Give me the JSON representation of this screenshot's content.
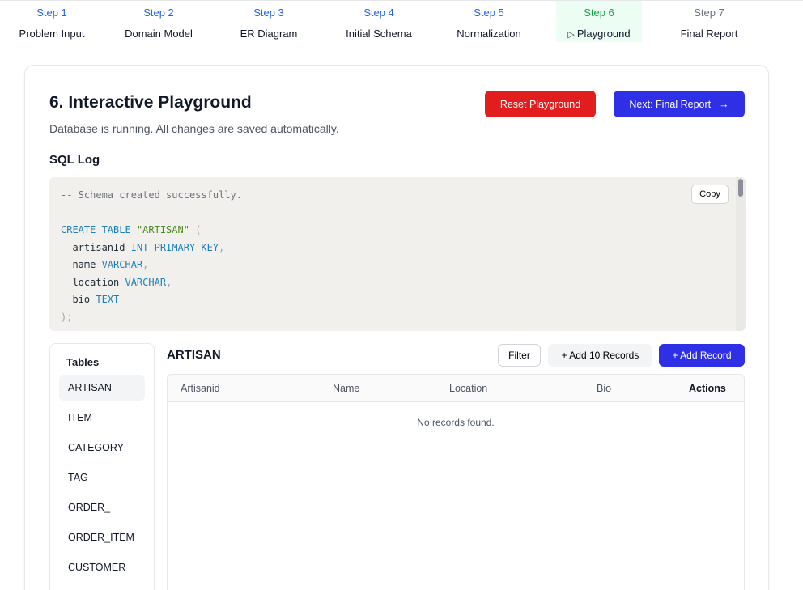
{
  "steps": [
    {
      "num": "Step 1",
      "label": "Problem Input"
    },
    {
      "num": "Step 2",
      "label": "Domain Model"
    },
    {
      "num": "Step 3",
      "label": "ER Diagram"
    },
    {
      "num": "Step 4",
      "label": "Initial Schema"
    },
    {
      "num": "Step 5",
      "label": "Normalization"
    },
    {
      "num": "Step 6",
      "label": "Playground"
    },
    {
      "num": "Step 7",
      "label": "Final Report"
    }
  ],
  "page": {
    "title": "6. Interactive Playground",
    "subtitle": "Database is running. All changes are saved automatically.",
    "reset_label": "Reset Playground",
    "next_label": "Next: Final Report",
    "next_arrow": "→"
  },
  "sql": {
    "heading": "SQL Log",
    "copy_label": "Copy",
    "comment": "-- Schema created successfully.",
    "create_kw": "CREATE TABLE",
    "table_name": "\"ARTISAN\"",
    "open_paren": "(",
    "col1_name": "artisanId",
    "col1_type": "INT PRIMARY KEY",
    "col2_name": "name",
    "col2_type": "VARCHAR",
    "col3_name": "location",
    "col3_type": "VARCHAR",
    "col4_name": "bio",
    "col4_type": "TEXT",
    "comma": ",",
    "close": ");"
  },
  "tables": {
    "title": "Tables",
    "items": [
      "ARTISAN",
      "ITEM",
      "CATEGORY",
      "TAG",
      "ORDER_",
      "ORDER_ITEM",
      "CUSTOMER"
    ]
  },
  "data_view": {
    "entity": "ARTISAN",
    "filter_label": "Filter",
    "add10_label": "+ Add 10 Records",
    "add_label": "+ Add Record",
    "columns": [
      "Artisanid",
      "Name",
      "Location",
      "Bio",
      "Actions"
    ],
    "empty_text": "No records found."
  },
  "colors": {
    "primary": "#2f2fe6",
    "danger": "#e11d1d",
    "step_done": "#2563eb",
    "step_active": "#16a34a"
  }
}
